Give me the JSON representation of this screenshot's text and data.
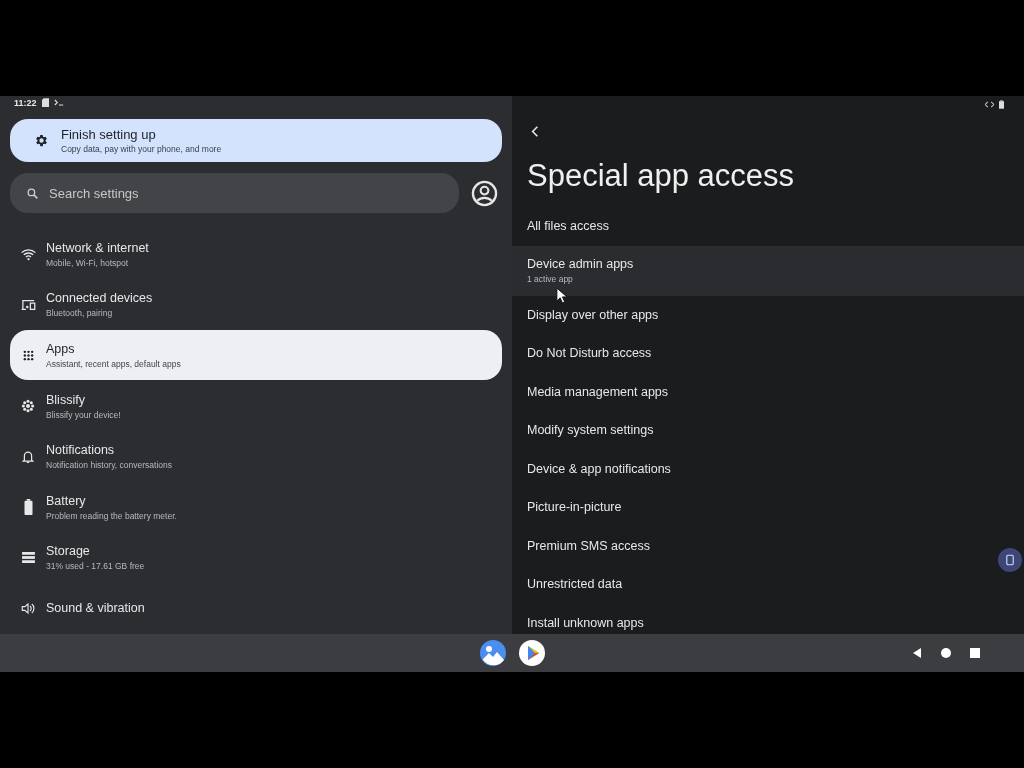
{
  "status_bar": {
    "time": "11:22"
  },
  "setup_card": {
    "title": "Finish setting up",
    "subtitle": "Copy data, pay with your phone, and more"
  },
  "search": {
    "placeholder": "Search settings"
  },
  "settings": [
    {
      "kind": "wifi",
      "title": "Network & internet",
      "subtitle": "Mobile, Wi-Fi, hotspot",
      "selected": false
    },
    {
      "kind": "devices",
      "title": "Connected devices",
      "subtitle": "Bluetooth, pairing",
      "selected": false
    },
    {
      "kind": "apps",
      "title": "Apps",
      "subtitle": "Assistant, recent apps, default apps",
      "selected": true
    },
    {
      "kind": "flower",
      "title": "Blissify",
      "subtitle": "Blissify your device!",
      "selected": false
    },
    {
      "kind": "bell",
      "title": "Notifications",
      "subtitle": "Notification history, conversations",
      "selected": false
    },
    {
      "kind": "battery",
      "title": "Battery",
      "subtitle": "Problem reading the battery meter.",
      "selected": false
    },
    {
      "kind": "storage",
      "title": "Storage",
      "subtitle": "31% used - 17.61 GB free",
      "selected": false
    },
    {
      "kind": "sound",
      "title": "Sound & vibration",
      "selected": false
    }
  ],
  "page": {
    "title": "Special app access",
    "items": [
      {
        "title": "All files access",
        "hovered": false
      },
      {
        "title": "Device admin apps",
        "subtitle": "1 active app",
        "hovered": true
      },
      {
        "title": "Display over other apps",
        "hovered": false
      },
      {
        "title": "Do Not Disturb access",
        "hovered": false
      },
      {
        "title": "Media management apps",
        "hovered": false
      },
      {
        "title": "Modify system settings",
        "hovered": false
      },
      {
        "title": "Device & app notifications",
        "hovered": false
      },
      {
        "title": "Picture-in-picture",
        "hovered": false
      },
      {
        "title": "Premium SMS access",
        "hovered": false
      },
      {
        "title": "Unrestricted data",
        "hovered": false
      },
      {
        "title": "Install unknown apps",
        "hovered": false
      }
    ]
  }
}
